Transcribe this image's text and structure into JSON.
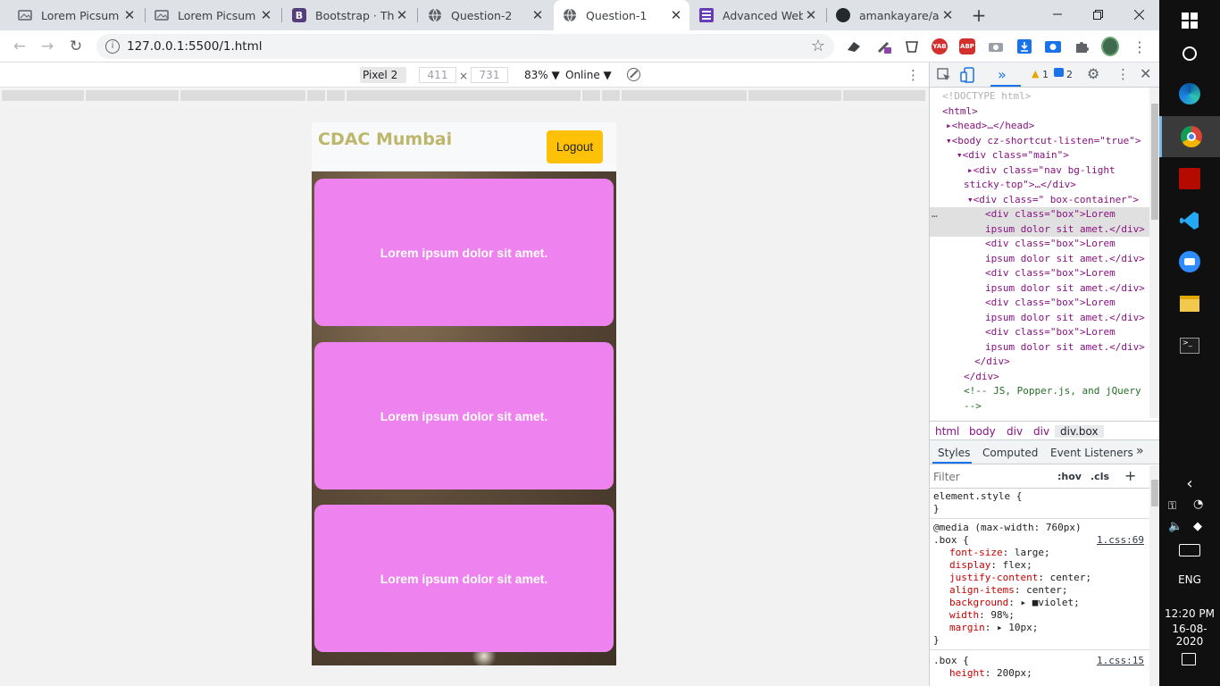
{
  "tabs": [
    {
      "title": "Lorem Picsum",
      "icon": "picsum-icon"
    },
    {
      "title": "Lorem Picsum - I",
      "icon": "picsum-icon"
    },
    {
      "title": "Bootstrap · The r",
      "icon": "bootstrap-icon"
    },
    {
      "title": "Question-2",
      "icon": "globe-icon"
    },
    {
      "title": "Question-1",
      "icon": "globe-icon"
    },
    {
      "title": "Advanced Web F",
      "icon": "list-icon"
    },
    {
      "title": "amankayare/awp",
      "icon": "github-icon"
    }
  ],
  "address": {
    "url": "127.0.0.1:5500/1.html"
  },
  "device_toolbar": {
    "device": "Pixel 2 ▼",
    "width": "411",
    "x": "×",
    "height": "731",
    "zoom": "83% ▼",
    "network": "Online ▼"
  },
  "page": {
    "brand": "CDAC Mumbai",
    "logout": "Logout",
    "boxes": [
      "Lorem ipsum dolor sit amet.",
      "Lorem ipsum dolor sit amet.",
      "Lorem ipsum dolor sit amet."
    ]
  },
  "devtools": {
    "warnings": "1",
    "messages": "2",
    "crumbs": [
      "html",
      "body",
      "div",
      "div",
      "div.box"
    ],
    "style_tabs": [
      "Styles",
      "Computed",
      "Event Listeners",
      "»"
    ],
    "filter_placeholder": "Filter",
    "hov": ":hov",
    "cls": ".cls",
    "plus": "+",
    "element_style": "element.style {",
    "close_brace": "}",
    "media": "@media (max-width: 760px)",
    "rule1_selector": ".box {",
    "rule1_src": "1.css:69",
    "rule1_props": [
      [
        "font-size",
        "large;"
      ],
      [
        "display",
        "flex;"
      ],
      [
        "justify-content",
        "center;"
      ],
      [
        "align-items",
        "center;"
      ],
      [
        "background",
        "▸ ■violet;"
      ],
      [
        "width",
        "98%;"
      ],
      [
        "margin",
        "▸ 10px;"
      ]
    ],
    "rule2_selector": ".box {",
    "rule2_src": "1.css:15",
    "rule2_props": [
      [
        "height",
        "200px;"
      ]
    ]
  },
  "dom_lines": [
    {
      "t": "<!DOCTYPE html>",
      "c": "dt",
      "x": 14
    },
    {
      "t": "<html>",
      "c": "tag",
      "x": 14
    },
    {
      "t": "▸<head>…</head>",
      "c": "tag",
      "x": 18
    },
    {
      "t": "▾<body cz-shortcut-listen=\"true\">",
      "c": "tag",
      "x": 18
    },
    {
      "t": "▾<div class=\"main\">",
      "c": "tag",
      "x": 30
    },
    {
      "t": "▸<div class=\"nav bg-light",
      "c": "tag",
      "x": 42
    },
    {
      "t": "sticky-top\">…</div>",
      "c": "tag",
      "x": 38
    },
    {
      "t": "▾<div class=\" box-container\">",
      "c": "tag",
      "x": 42
    },
    {
      "t": "<div class=\"box\">Lorem",
      "c": "tag",
      "x": 62,
      "sel": true
    },
    {
      "t": "ipsum dolor sit amet.</div>",
      "c": "tag",
      "x": 62,
      "sel": true
    },
    {
      "t": "<div class=\"box\">Lorem",
      "c": "tag",
      "x": 62
    },
    {
      "t": "ipsum dolor sit amet.</div>",
      "c": "tag",
      "x": 62
    },
    {
      "t": "<div class=\"box\">Lorem",
      "c": "tag",
      "x": 62
    },
    {
      "t": "ipsum dolor sit amet.</div>",
      "c": "tag",
      "x": 62
    },
    {
      "t": "<div class=\"box\">Lorem",
      "c": "tag",
      "x": 62
    },
    {
      "t": "ipsum dolor sit amet.</div>",
      "c": "tag",
      "x": 62
    },
    {
      "t": "<div class=\"box\">Lorem",
      "c": "tag",
      "x": 62
    },
    {
      "t": "ipsum dolor sit amet.</div>",
      "c": "tag",
      "x": 62
    },
    {
      "t": "</div>",
      "c": "tag",
      "x": 50
    },
    {
      "t": "</div>",
      "c": "tag",
      "x": 38
    },
    {
      "t": "<!-- JS, Popper.js, and jQuery",
      "c": "cm",
      "x": 38
    },
    {
      "t": "-->",
      "c": "cm",
      "x": 38
    }
  ],
  "taskbar": {
    "time": "12:20 PM",
    "date": "16-08-2020",
    "lang": "ENG"
  }
}
